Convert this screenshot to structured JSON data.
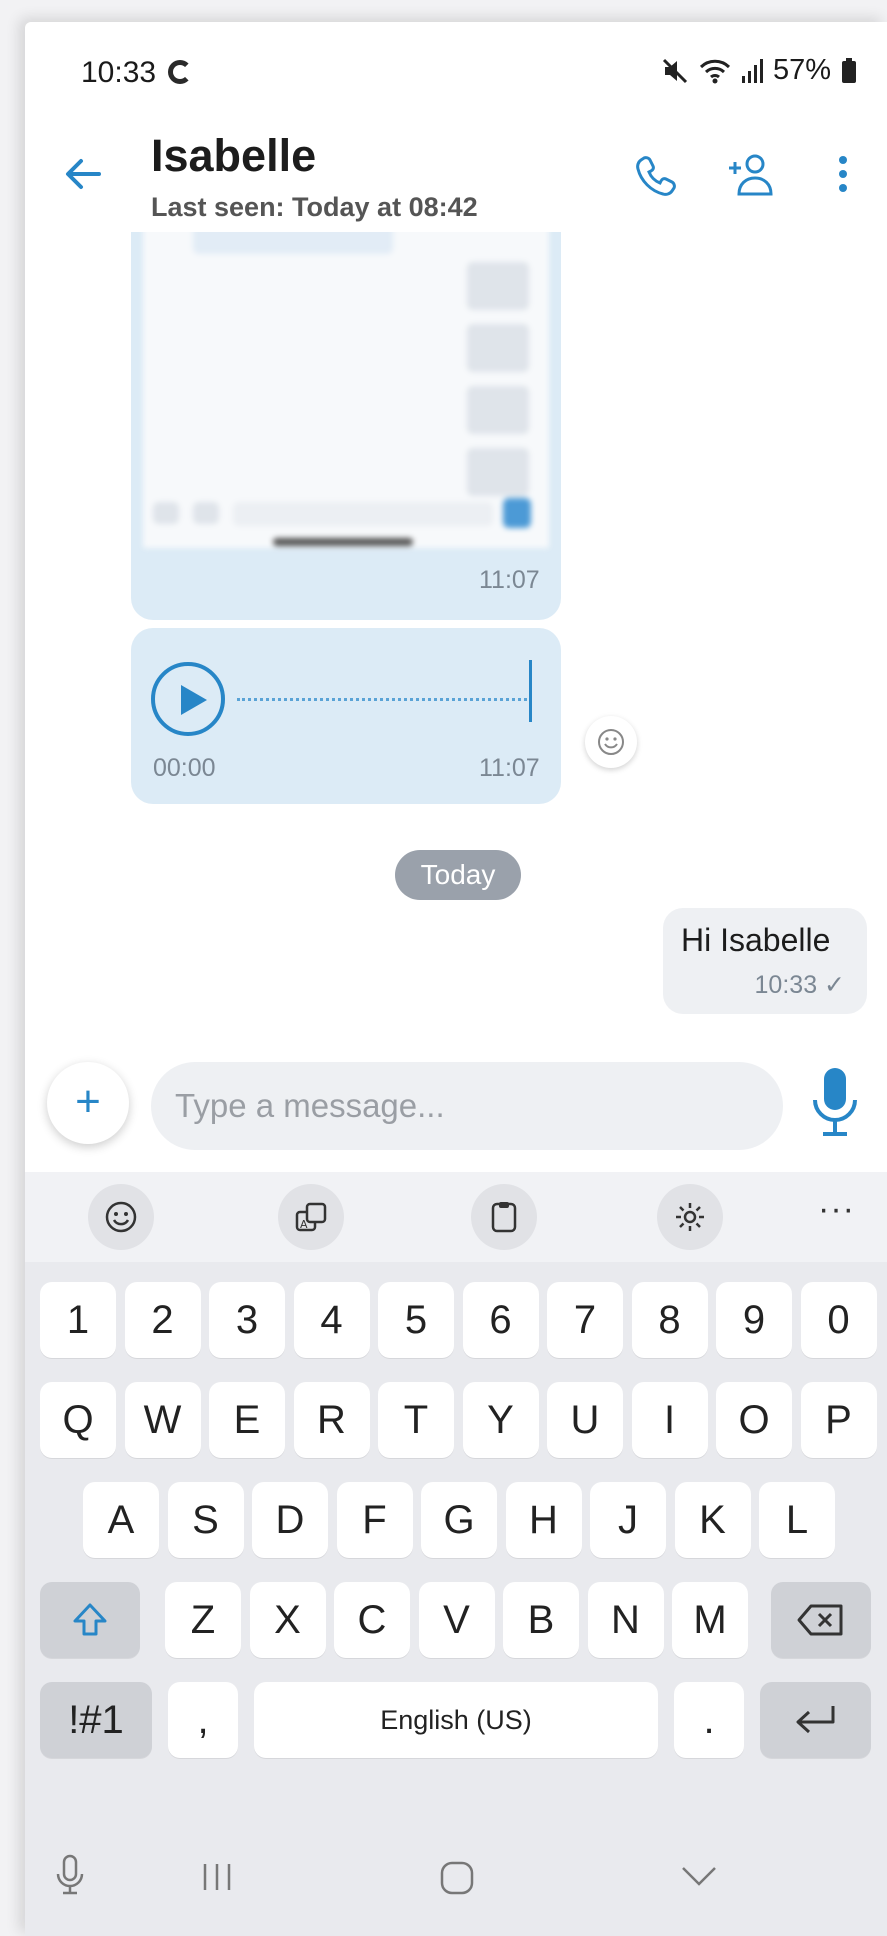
{
  "status": {
    "time": "10:33",
    "battery": "57%"
  },
  "header": {
    "contact_name": "Isabelle",
    "last_seen": "Last seen: Today at 08:42"
  },
  "chat": {
    "image_msg_time": "11:07",
    "voice_msg": {
      "duration": "00:00",
      "time": "11:07"
    },
    "date_divider": "Today",
    "outgoing": {
      "text": "Hi Isabelle",
      "time": "10:33 ✓"
    }
  },
  "compose": {
    "placeholder": "Type a message..."
  },
  "keyboard": {
    "number_row": [
      "1",
      "2",
      "3",
      "4",
      "5",
      "6",
      "7",
      "8",
      "9",
      "0"
    ],
    "row1": [
      "Q",
      "W",
      "E",
      "R",
      "T",
      "Y",
      "U",
      "I",
      "O",
      "P"
    ],
    "row2": [
      "A",
      "S",
      "D",
      "F",
      "G",
      "H",
      "J",
      "K",
      "L"
    ],
    "row3": [
      "Z",
      "X",
      "C",
      "V",
      "B",
      "N",
      "M"
    ],
    "symbols": "!#1",
    "comma": ",",
    "space": "English (US)",
    "period": ".",
    "more": "···"
  },
  "colors": {
    "accent": "#2786c7",
    "incoming_bubble": "#dcebf6",
    "outgoing_bubble": "#eef0f3"
  }
}
